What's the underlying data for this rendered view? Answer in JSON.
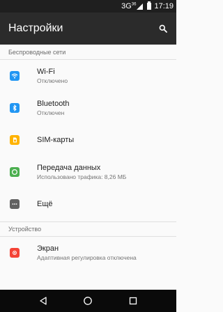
{
  "status_bar": {
    "network": "3G",
    "network_sup": "36",
    "time": "17:19"
  },
  "app_bar": {
    "title": "Настройки",
    "search_icon": "search-icon"
  },
  "sections": {
    "wireless": {
      "header": "Беспроводные сети",
      "items": [
        {
          "label": "Wi-Fi",
          "sub": "Отключено",
          "icon": "wifi-icon",
          "color": "#2196f3"
        },
        {
          "label": "Bluetooth",
          "sub": "Отключен",
          "icon": "bluetooth-icon",
          "color": "#2196f3"
        },
        {
          "label": "SIM-карты",
          "sub": "",
          "icon": "sim-card-icon",
          "color": "#ffb300"
        },
        {
          "label": "Передача данных",
          "sub": "Использовано трафика: 8,26 МБ",
          "icon": "data-usage-icon",
          "color": "#4caf50"
        },
        {
          "label": "Ещё",
          "sub": "",
          "icon": "more-icon",
          "color": "#616161"
        }
      ]
    },
    "device": {
      "header": "Устройство",
      "items": [
        {
          "label": "Экран",
          "sub": "Адаптивная регулировка отключена",
          "icon": "display-icon",
          "color": "#f44336"
        }
      ]
    }
  },
  "nav_bar": {
    "back": "back-icon",
    "home": "home-icon",
    "recents": "recents-icon"
  }
}
